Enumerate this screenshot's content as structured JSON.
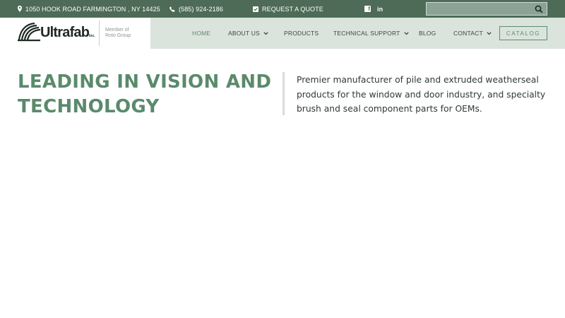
{
  "topbar": {
    "address": "1050 HOOK ROAD FARMINGTON , NY  14425",
    "phone": "(585) 924-2186",
    "quote": "REQUEST A QUOTE",
    "social": {
      "facebook": "f",
      "linkedin": "in"
    },
    "search": {
      "value": "",
      "placeholder": ""
    },
    "icons": [
      "map-pin-icon",
      "phone-icon",
      "check-square-icon",
      "facebook-icon",
      "linkedin-icon",
      "search-icon"
    ]
  },
  "header": {
    "logo": {
      "name": "Ultrafab",
      "suffix": "inc."
    },
    "member_line1": "Member of",
    "member_line2": "Roto Group",
    "nav": [
      {
        "label": "HOME",
        "active": true
      },
      {
        "label": "ABOUT US",
        "dropdown": true
      },
      {
        "label": "PRODUCTS"
      },
      {
        "label": "TECHNICAL SUPPORT",
        "dropdown": true
      },
      {
        "label": "BLOG"
      },
      {
        "label": "CONTACT",
        "dropdown": true
      }
    ],
    "catalog_label": "CATALOG"
  },
  "hero": {
    "title": "LEADING IN VISION AND TECHNOLOGY",
    "description": "Premier manufacturer of pile and extruded weatherseal products for the window and door industry, and specialty brush and seal component parts for OEMs."
  },
  "colors": {
    "topbar_bg": "#4d6b56",
    "header_bg": "#dbe3dd",
    "accent_green": "#5a8a6b",
    "nav_text": "#344a3c"
  }
}
